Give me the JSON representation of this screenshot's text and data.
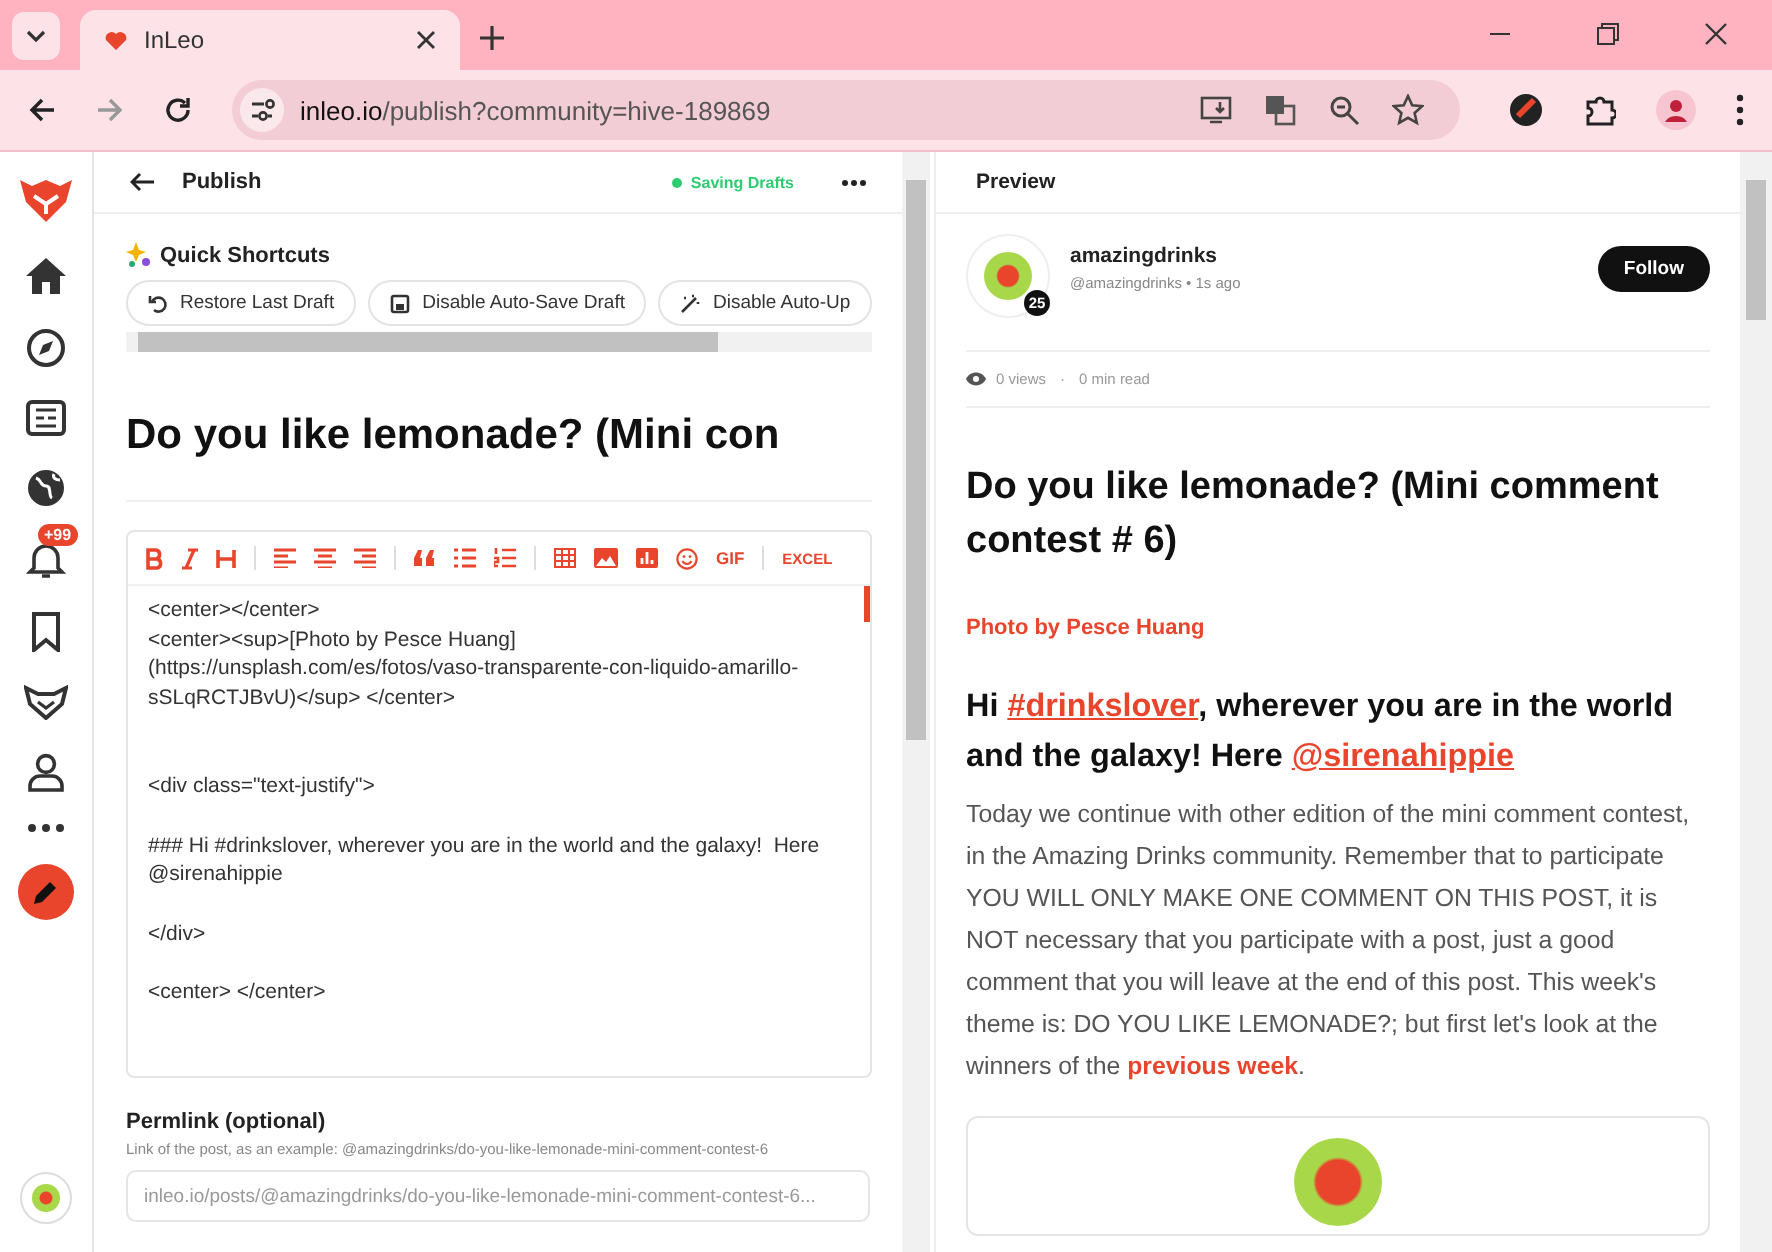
{
  "browser": {
    "tabs": [
      {
        "title": "InLeo",
        "selected": true
      }
    ],
    "url": {
      "host": "inleo.io",
      "path": "/publish?community=hive-189869"
    }
  },
  "sidebar": {
    "notification_badge": "+99"
  },
  "editor": {
    "title": "Publish",
    "status": "Saving Drafts",
    "shortcuts_title": "Quick Shortcuts",
    "shortcuts": [
      {
        "label": "Restore Last Draft",
        "kind": "restore"
      },
      {
        "label": "Disable Auto-Save Draft",
        "kind": "save"
      },
      {
        "label": "Disable Auto-Up",
        "kind": "magic"
      }
    ],
    "post_title": "Do you like lemonade? (Mini con",
    "toolbar_text": [
      "GIF",
      "EXCEL"
    ],
    "body": "<center></center>\n<center><sup>[Photo by Pesce Huang]\n(https://unsplash.com/es/fotos/vaso-transparente-con-liquido-amarillo-\nsSLqRCTJBvU)</sup> </center>\n\n\n<div class=\"text-justify\">\n\n### Hi #drinkslover, wherever you are in the world and the galaxy!  Here\n@sirenahippie\n\n</div>\n\n<center> </center>",
    "permlink_label": "Permlink (optional)",
    "permlink_hint": "Link of the post, as an example: @amazingdrinks/do-you-like-lemonade-mini-comment-contest-6",
    "permlink_placeholder": "inleo.io/posts/@amazingdrinks/do-you-like-lemonade-mini-comment-contest-6..."
  },
  "preview": {
    "title": "Preview",
    "author": "amazingdrinks",
    "handle": "@amazingdrinks",
    "time": "1s ago",
    "meta_separator": "•",
    "stats_separator": "·",
    "reputation": "25",
    "follow": "Follow",
    "views": "0 views",
    "read_time": "0 min read",
    "post_title": "Do you like lemonade? (Mini comment contest # 6)",
    "photo_credit": "Photo by Pesce Huang",
    "heading": [
      {
        "kind": "text",
        "text": "Hi "
      },
      {
        "kind": "link",
        "text": "#drinkslover"
      },
      {
        "kind": "text",
        "text": ", wherever you are in the world and the galaxy! Here "
      },
      {
        "kind": "link",
        "text": "@sirenahippie"
      }
    ],
    "paragraph": [
      {
        "kind": "text",
        "text": "Today we continue with other edition of the mini comment contest, in the Amazing Drinks community. Remember that to participate YOU WILL ONLY MAKE ONE COMMENT ON THIS POST, it is NOT necessary that you participate with a post, just a good comment that you will leave at the end of this post. This week's theme is: DO YOU LIKE LEMONADE?; but first let's look at the winners of the "
      },
      {
        "kind": "link",
        "text": "previous week"
      },
      {
        "kind": "text",
        "text": "."
      }
    ]
  }
}
